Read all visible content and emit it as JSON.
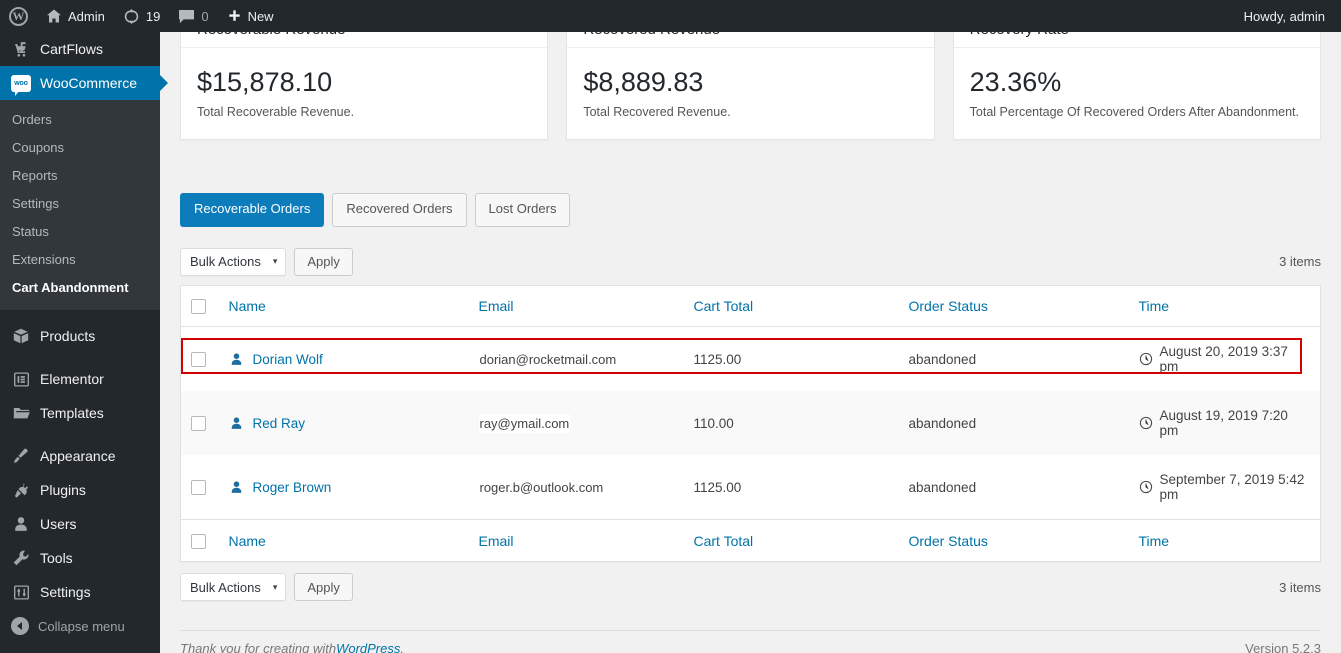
{
  "adminbar": {
    "wp_logo": "wordpress-logo",
    "site_name": "Admin",
    "updates_count": "19",
    "comments_count": "0",
    "new_label": "New",
    "howdy": "Howdy, admin"
  },
  "sidebar": {
    "top_items": [
      {
        "label": "CartFlows",
        "icon": "cartflows-icon",
        "current": false
      },
      {
        "label": "WooCommerce",
        "icon": "woocommerce-icon",
        "current": true
      }
    ],
    "woo_submenu": [
      {
        "label": "Orders",
        "current": false
      },
      {
        "label": "Coupons",
        "current": false
      },
      {
        "label": "Reports",
        "current": false
      },
      {
        "label": "Settings",
        "current": false
      },
      {
        "label": "Status",
        "current": false
      },
      {
        "label": "Extensions",
        "current": false
      },
      {
        "label": "Cart Abandonment",
        "current": true
      }
    ],
    "lower_items": [
      {
        "label": "Products",
        "icon": "box-icon"
      },
      {
        "label": "Elementor",
        "icon": "elementor-icon"
      },
      {
        "label": "Templates",
        "icon": "folder-icon"
      },
      {
        "label": "Appearance",
        "icon": "paintbrush-icon"
      },
      {
        "label": "Plugins",
        "icon": "plug-icon"
      },
      {
        "label": "Users",
        "icon": "user-icon"
      },
      {
        "label": "Tools",
        "icon": "wrench-icon"
      },
      {
        "label": "Settings",
        "icon": "sliders-icon"
      }
    ],
    "collapse_label": "Collapse menu"
  },
  "cards": [
    {
      "title": "Recoverable Revenue",
      "value": "$15,878.10",
      "caption": "Total Recoverable Revenue."
    },
    {
      "title": "Recovered Revenue",
      "value": "$8,889.83",
      "caption": "Total Recovered Revenue."
    },
    {
      "title": "Recovery Rate",
      "value": "23.36%",
      "caption": "Total Percentage Of Recovered Orders After Abandonment."
    }
  ],
  "tabs": [
    {
      "label": "Recoverable Orders",
      "active": true
    },
    {
      "label": "Recovered Orders",
      "active": false
    },
    {
      "label": "Lost Orders",
      "active": false
    }
  ],
  "tablenav": {
    "bulk_actions_label": "Bulk Actions",
    "caret": "▾",
    "apply_label": "Apply",
    "items_count": "3 items"
  },
  "table": {
    "columns": [
      {
        "key": "name",
        "label": "Name"
      },
      {
        "key": "email",
        "label": "Email"
      },
      {
        "key": "cart_total",
        "label": "Cart Total"
      },
      {
        "key": "order_status",
        "label": "Order Status"
      },
      {
        "key": "time",
        "label": "Time"
      }
    ],
    "rows": [
      {
        "name": "Dorian Wolf",
        "email": "dorian@rocketmail.com",
        "cart_total": "1125.00",
        "order_status": "abandoned",
        "time": "August 20, 2019 3:37 pm",
        "highlighted": true
      },
      {
        "name": "Red Ray",
        "email": "ray@ymail.com",
        "cart_total": "110.00",
        "order_status": "abandoned",
        "time": "August 19, 2019 7:20 pm",
        "highlighted": false
      },
      {
        "name": "Roger Brown",
        "email": "roger.b@outlook.com",
        "cart_total": "1125.00",
        "order_status": "abandoned",
        "time": "September 7, 2019 5:42 pm",
        "highlighted": false
      }
    ]
  },
  "footer": {
    "thanks_prefix": "Thank you for creating with ",
    "wordpress_link": "WordPress",
    "thanks_suffix": ".",
    "version": "Version 5.2.3"
  },
  "colors": {
    "accent": "#0073aa",
    "tab_active": "#0d7cbb",
    "sidebar_bg": "#23282d",
    "submenu_bg": "#32373c",
    "highlight_border": "#d30000",
    "content_bg": "#f1f1f1"
  }
}
